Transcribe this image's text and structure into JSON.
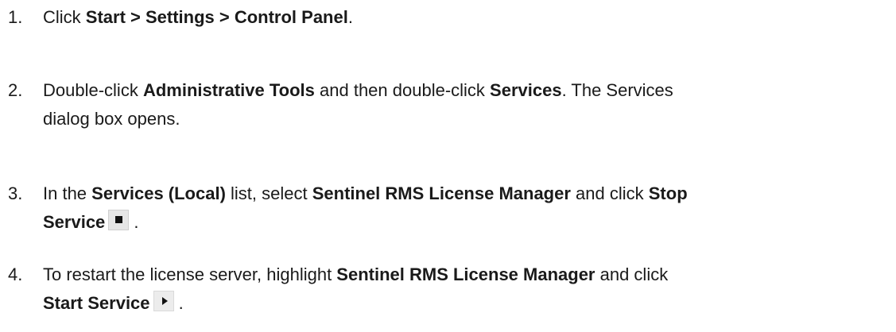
{
  "steps": [
    {
      "number": "1.",
      "lines": [
        [
          {
            "t": "Click "
          },
          {
            "t": "Start > Settings > Control Panel",
            "b": true
          },
          {
            "t": "."
          }
        ]
      ]
    },
    {
      "number": "2.",
      "lines": [
        [
          {
            "t": "Double-click "
          },
          {
            "t": "Administrative Tools",
            "b": true
          },
          {
            "t": " and then double-click "
          },
          {
            "t": "Services",
            "b": true
          },
          {
            "t": ". The Services"
          }
        ],
        [
          {
            "t": "dialog box opens."
          }
        ]
      ]
    },
    {
      "number": "3.",
      "lines": [
        [
          {
            "t": "In the "
          },
          {
            "t": "Services (Local)",
            "b": true
          },
          {
            "t": " list, select "
          },
          {
            "t": "Sentinel RMS License Manager",
            "b": true
          },
          {
            "t": " and click "
          },
          {
            "t": "Stop",
            "b": true
          }
        ],
        [
          {
            "t": "Service",
            "b": true
          },
          {
            "icon": "stop-service-icon"
          },
          {
            "t": " ."
          }
        ]
      ]
    },
    {
      "number": "4.",
      "lines": [
        [
          {
            "t": "To restart the license server, highlight "
          },
          {
            "t": "Sentinel RMS License Manager",
            "b": true
          },
          {
            "t": " and click"
          }
        ],
        [
          {
            "t": "Start Service",
            "b": true
          },
          {
            "icon": "start-service-icon"
          },
          {
            "t": " ."
          }
        ]
      ]
    }
  ]
}
